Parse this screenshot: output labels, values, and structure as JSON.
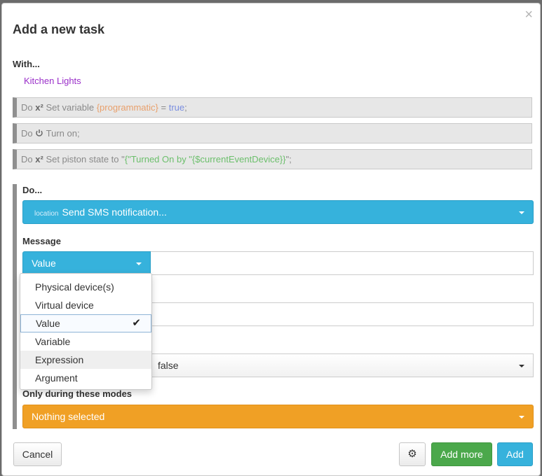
{
  "modal": {
    "title": "Add a new task",
    "close_glyph": "×",
    "with_label": "With...",
    "with_device": "Kitchen Lights"
  },
  "tasks": [
    {
      "do": "Do",
      "sym": "x²",
      "text": "Set variable",
      "var": "{programmatic}",
      "eq": "=",
      "val": "true",
      "end": ";"
    },
    {
      "do": "Do",
      "text": "Turn on;"
    },
    {
      "do": "Do",
      "sym": "x²",
      "text": "Set piston state to \"",
      "str": "{\"Turned On by \"{$currentEventDevice}}",
      "end": "\";"
    }
  ],
  "do_block": {
    "label": "Do...",
    "command_prefix": "location",
    "command": "Send SMS notification...",
    "message_label": "Message",
    "value_type": "Value",
    "third_value": "false",
    "modes_label": "Only during these modes",
    "modes_value": "Nothing selected"
  },
  "dropdown": {
    "items": [
      "Physical device(s)",
      "Virtual device",
      "Value",
      "Variable",
      "Expression",
      "Argument"
    ],
    "selected_index": 2,
    "hover_index": 4,
    "check_glyph": "✔"
  },
  "footer": {
    "cancel": "Cancel",
    "gear_glyph": "⚙",
    "add_more": "Add more",
    "add": "Add"
  },
  "colors": {
    "primary": "#36b2dc",
    "success": "#4ba84b",
    "warning": "#f0a025",
    "device": "#9a2fc9"
  }
}
